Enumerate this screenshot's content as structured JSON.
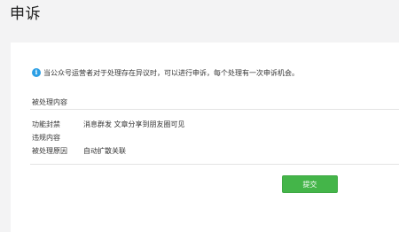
{
  "header": {
    "title": "申诉"
  },
  "notice": {
    "icon": "info-icon",
    "icon_glyph": "i",
    "text": "当公众号运营者对于处理存在异议时，可以进行申诉，每个处理有一次申诉机会。",
    "accent_color": "#2c9fe5"
  },
  "section": {
    "title": "被处理内容"
  },
  "details": [
    {
      "label": "功能封禁",
      "value": "消息群发 文章分享到朋友圈可见"
    },
    {
      "label": "违规内容",
      "value": ""
    },
    {
      "label": "被处理原因",
      "value": "自动扩散关联"
    }
  ],
  "actions": {
    "submit_label": "提交",
    "submit_color": "#44b549"
  }
}
